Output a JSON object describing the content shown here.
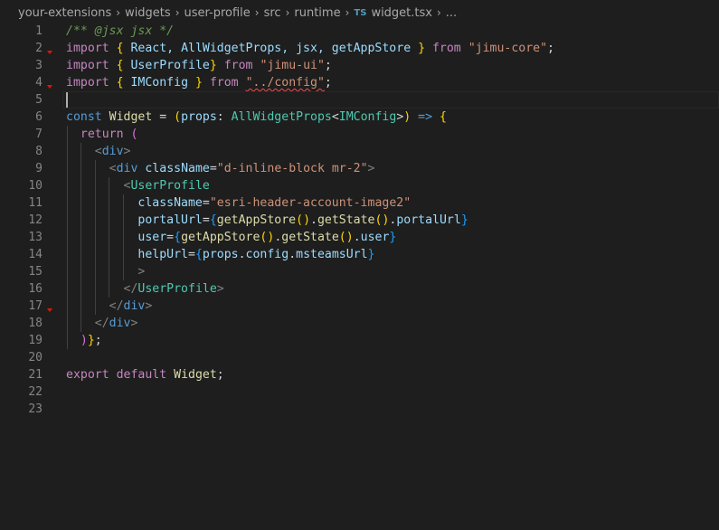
{
  "breadcrumb": {
    "items": [
      "your-extensions",
      "widgets",
      "user-profile",
      "src",
      "runtime"
    ],
    "file_icon": "TS",
    "file_name": "widget.tsx",
    "ellipsis": "..."
  },
  "editor": {
    "cursor_line": 5,
    "lines": [
      {
        "n": "1",
        "tokens": [
          [
            "/** @jsx jsx */",
            "comment"
          ]
        ]
      },
      {
        "n": "2",
        "tokens": [
          [
            "import",
            "kw"
          ],
          [
            " ",
            "plain"
          ],
          [
            "{",
            "brace"
          ],
          [
            " React, AllWidgetProps, jsx, getAppStore ",
            "var"
          ],
          [
            "}",
            "brace"
          ],
          [
            " ",
            "plain"
          ],
          [
            "from",
            "kw"
          ],
          [
            " ",
            "plain"
          ],
          [
            "\"jimu-core\"",
            "str"
          ],
          [
            ";",
            "plain"
          ]
        ]
      },
      {
        "n": "3",
        "tokens": [
          [
            "import",
            "kw"
          ],
          [
            " ",
            "plain"
          ],
          [
            "{",
            "brace"
          ],
          [
            " UserProfile",
            "var"
          ],
          [
            "}",
            "brace"
          ],
          [
            " ",
            "plain"
          ],
          [
            "from",
            "kw"
          ],
          [
            " ",
            "plain"
          ],
          [
            "\"jimu-ui\"",
            "str"
          ],
          [
            ";",
            "plain"
          ]
        ]
      },
      {
        "n": "4",
        "tokens": [
          [
            "import",
            "kw"
          ],
          [
            " ",
            "plain"
          ],
          [
            "{",
            "brace"
          ],
          [
            " IMConfig ",
            "var"
          ],
          [
            "}",
            "brace"
          ],
          [
            " ",
            "plain"
          ],
          [
            "from",
            "kw"
          ],
          [
            " ",
            "plain"
          ],
          [
            "\"../config\"",
            "str-squiggle"
          ],
          [
            ";",
            "plain"
          ]
        ]
      },
      {
        "n": "5",
        "tokens": []
      },
      {
        "n": "6",
        "tokens": [
          [
            "const",
            "kw2"
          ],
          [
            " ",
            "plain"
          ],
          [
            "Widget",
            "func"
          ],
          [
            " = ",
            "plain"
          ],
          [
            "(",
            "brace"
          ],
          [
            "props",
            "var"
          ],
          [
            ": ",
            "plain"
          ],
          [
            "AllWidgetProps",
            "type"
          ],
          [
            "<",
            "plain"
          ],
          [
            "IMConfig",
            "type"
          ],
          [
            ">",
            "plain"
          ],
          [
            ")",
            "brace"
          ],
          [
            " ",
            "plain"
          ],
          [
            "=>",
            "kw2"
          ],
          [
            " ",
            "plain"
          ],
          [
            "{",
            "brace"
          ]
        ]
      },
      {
        "n": "7",
        "tokens": [
          [
            "  ",
            "plain"
          ],
          [
            "return",
            "kw"
          ],
          [
            " ",
            "plain"
          ],
          [
            "(",
            "paren"
          ]
        ]
      },
      {
        "n": "8",
        "tokens": [
          [
            "    ",
            "plain"
          ],
          [
            "<",
            "punc"
          ],
          [
            "div",
            "tag"
          ],
          [
            ">",
            "punc"
          ]
        ]
      },
      {
        "n": "9",
        "tokens": [
          [
            "      ",
            "plain"
          ],
          [
            "<",
            "punc"
          ],
          [
            "div",
            "tag"
          ],
          [
            " ",
            "plain"
          ],
          [
            "className",
            "attr"
          ],
          [
            "=",
            "plain"
          ],
          [
            "\"d-inline-block mr-2\"",
            "str"
          ],
          [
            ">",
            "punc"
          ]
        ]
      },
      {
        "n": "10",
        "tokens": [
          [
            "        ",
            "plain"
          ],
          [
            "<",
            "punc"
          ],
          [
            "UserProfile",
            "comp"
          ]
        ]
      },
      {
        "n": "11",
        "tokens": [
          [
            "          ",
            "plain"
          ],
          [
            "className",
            "attr"
          ],
          [
            "=",
            "plain"
          ],
          [
            "\"esri-header-account-image2\"",
            "str"
          ]
        ]
      },
      {
        "n": "12",
        "tokens": [
          [
            "          ",
            "plain"
          ],
          [
            "portalUrl",
            "attr"
          ],
          [
            "=",
            "plain"
          ],
          [
            "{",
            "brace3"
          ],
          [
            "getAppStore",
            "func"
          ],
          [
            "()",
            "brace"
          ],
          [
            ".",
            "plain"
          ],
          [
            "getState",
            "func"
          ],
          [
            "()",
            "brace"
          ],
          [
            ".",
            "plain"
          ],
          [
            "portalUrl",
            "var"
          ],
          [
            "}",
            "brace3"
          ]
        ]
      },
      {
        "n": "13",
        "tokens": [
          [
            "          ",
            "plain"
          ],
          [
            "user",
            "attr"
          ],
          [
            "=",
            "plain"
          ],
          [
            "{",
            "brace3"
          ],
          [
            "getAppStore",
            "func"
          ],
          [
            "()",
            "brace"
          ],
          [
            ".",
            "plain"
          ],
          [
            "getState",
            "func"
          ],
          [
            "()",
            "brace"
          ],
          [
            ".",
            "plain"
          ],
          [
            "user",
            "var"
          ],
          [
            "}",
            "brace3"
          ]
        ]
      },
      {
        "n": "14",
        "tokens": [
          [
            "          ",
            "plain"
          ],
          [
            "helpUrl",
            "attr"
          ],
          [
            "=",
            "plain"
          ],
          [
            "{",
            "brace3"
          ],
          [
            "props",
            "var"
          ],
          [
            ".",
            "plain"
          ],
          [
            "config",
            "var"
          ],
          [
            ".",
            "plain"
          ],
          [
            "msteamsUrl",
            "var"
          ],
          [
            "}",
            "brace3"
          ]
        ]
      },
      {
        "n": "15",
        "tokens": [
          [
            "          ",
            "plain"
          ],
          [
            ">",
            "punc"
          ]
        ]
      },
      {
        "n": "16",
        "tokens": [
          [
            "        ",
            "plain"
          ],
          [
            "</",
            "punc"
          ],
          [
            "UserProfile",
            "comp"
          ],
          [
            ">",
            "punc"
          ]
        ]
      },
      {
        "n": "17",
        "tokens": [
          [
            "      ",
            "plain"
          ],
          [
            "</",
            "punc"
          ],
          [
            "div",
            "tag"
          ],
          [
            ">",
            "punc"
          ]
        ]
      },
      {
        "n": "18",
        "tokens": [
          [
            "    ",
            "plain"
          ],
          [
            "</",
            "punc"
          ],
          [
            "div",
            "tag"
          ],
          [
            ">",
            "punc"
          ]
        ]
      },
      {
        "n": "19",
        "tokens": [
          [
            "  ",
            "plain"
          ],
          [
            ")",
            "paren"
          ],
          [
            "}",
            "brace"
          ],
          [
            ";",
            "plain"
          ]
        ]
      },
      {
        "n": "20",
        "tokens": []
      },
      {
        "n": "21",
        "tokens": [
          [
            "export",
            "kw"
          ],
          [
            " ",
            "plain"
          ],
          [
            "default",
            "kw"
          ],
          [
            " ",
            "plain"
          ],
          [
            "Widget",
            "func"
          ],
          [
            ";",
            "plain"
          ]
        ]
      },
      {
        "n": "22",
        "tokens": []
      },
      {
        "n": "23",
        "tokens": []
      }
    ],
    "fold_marker_lines": [
      2,
      4,
      17
    ],
    "indent_guides": {
      "7": [
        1
      ],
      "8": [
        1,
        2
      ],
      "9": [
        1,
        2,
        3
      ],
      "10": [
        1,
        2,
        3,
        4
      ],
      "11": [
        1,
        2,
        3,
        4,
        5
      ],
      "12": [
        1,
        2,
        3,
        4,
        5
      ],
      "13": [
        1,
        2,
        3,
        4,
        5
      ],
      "14": [
        1,
        2,
        3,
        4,
        5
      ],
      "15": [
        1,
        2,
        3,
        4,
        5
      ],
      "16": [
        1,
        2,
        3,
        4
      ],
      "17": [
        1,
        2,
        3
      ],
      "18": [
        1,
        2
      ],
      "19": [
        1
      ]
    }
  }
}
